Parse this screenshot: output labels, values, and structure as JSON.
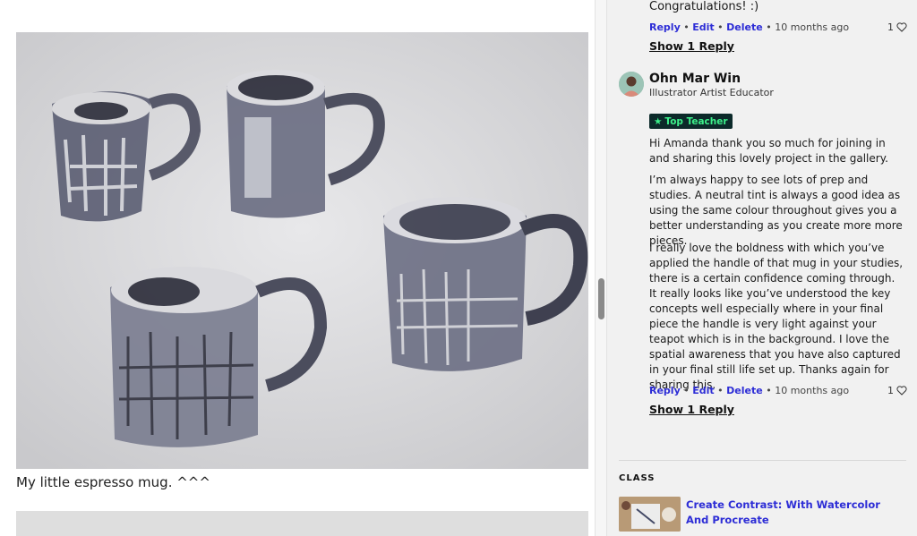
{
  "left_panel": {
    "caption": "My little espresso mug. ^^^"
  },
  "comments": {
    "previous": {
      "text": "Congratulations! :)",
      "actions": {
        "reply": "Reply",
        "edit": "Edit",
        "delete": "Delete",
        "sep": "•",
        "time": "10 months ago"
      },
      "likes": "1",
      "show_replies": "Show 1 Reply"
    },
    "teacher": {
      "name": "Ohn Mar Win",
      "role": "Illustrator Artist Educator",
      "badge": "Top Teacher",
      "paragraphs": [
        "Hi Amanda thank you so much for joining in and sharing this lovely project in the gallery.",
        "I’m always happy to see lots of prep and studies. A neutral tint is always a good idea as using the same colour throughout gives you a better understanding as you create more more pieces.",
        "I really love the boldness with which you’ve applied the handle of that mug in your studies, there is a certain confidence coming through. It really looks like you’ve understood the key concepts well especially where in your final piece the handle is very light against your teapot which is in the background. I love the spatial awareness that you have also captured in your final still life set up. Thanks again for sharing this."
      ],
      "actions": {
        "reply": "Reply",
        "edit": "Edit",
        "delete": "Delete",
        "sep": "•",
        "time": "10 months ago"
      },
      "likes": "1",
      "show_replies": "Show 1 Reply"
    }
  },
  "class_section": {
    "label": "CLASS",
    "title": "Create Contrast: With Watercolor And Procreate"
  },
  "colors": {
    "link": "#2d2dd6",
    "badge_bg": "#0c2a2a",
    "badge_text": "#3cf08a",
    "panel_bg": "#f1f1f1"
  }
}
